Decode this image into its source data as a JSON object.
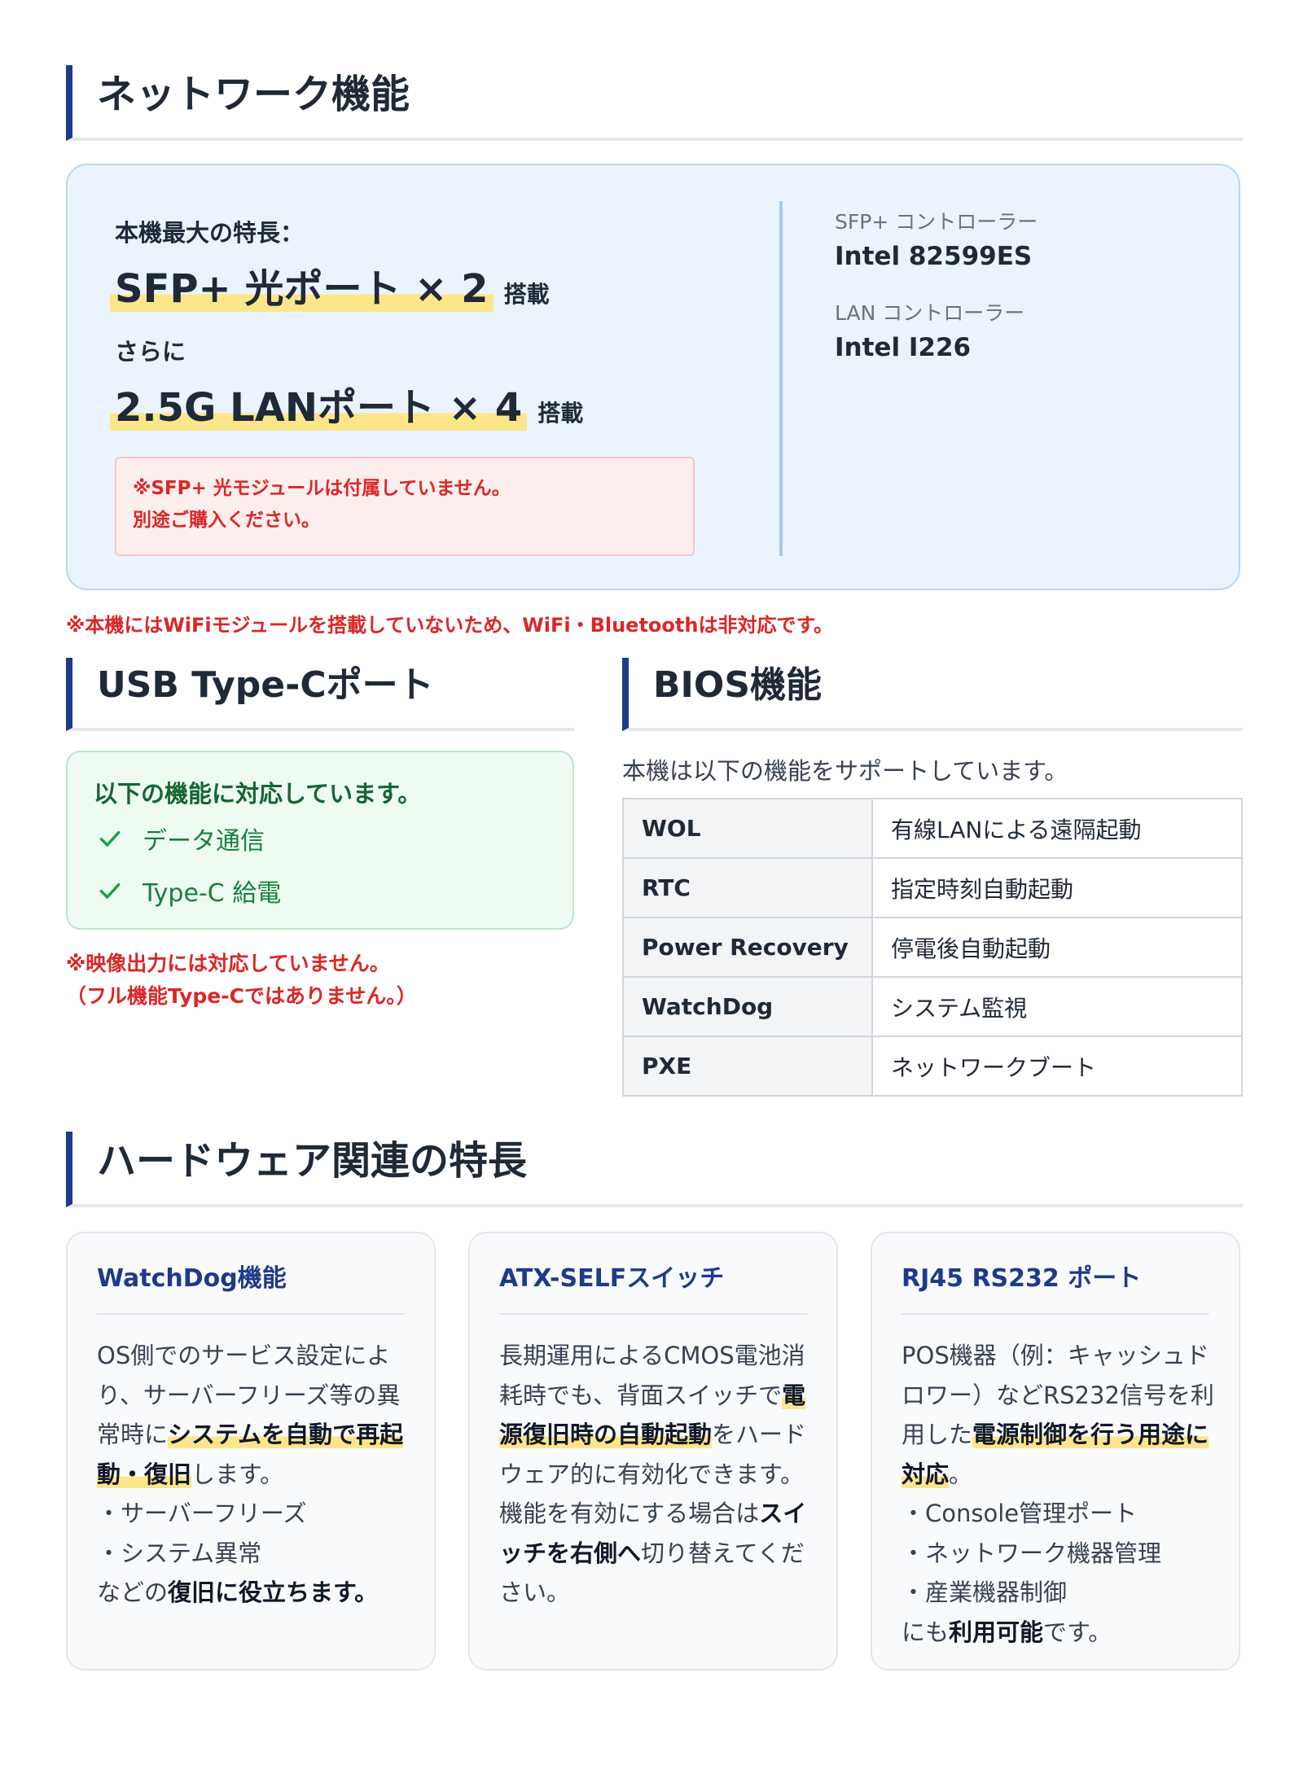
{
  "network": {
    "heading": "ネットワーク機能",
    "feature_label": "本機最大の特長：",
    "sfp_line": "SFP+ 光ポート × 2",
    "sfp_suffix": "搭載",
    "also": "さらに",
    "lan_line": "2.5G LANポート × 4",
    "lan_suffix": "搭載",
    "sfp_note_line1": "※SFP+ 光モジュールは付属していません。",
    "sfp_note_line2": "別途ご購入ください。",
    "sfp_controller_label": "SFP+ コントローラー",
    "sfp_controller_value": "Intel 82599ES",
    "lan_controller_label": "LAN コントローラー",
    "lan_controller_value": "Intel I226",
    "wifi_note": "※本機にはWiFiモジュールを搭載していないため、WiFi・Bluetoothは非対応です。"
  },
  "usb": {
    "heading": "USB Type-Cポート",
    "supported_label": "以下の機能に対応しています。",
    "features": [
      "データ通信",
      "Type-C 給電"
    ],
    "note_line1": "※映像出力には対応していません。",
    "note_line2": "（フル機能Type-Cではありません。）"
  },
  "bios": {
    "heading": "BIOS機能",
    "intro": "本機は以下の機能をサポートしています。",
    "rows": [
      {
        "key": "WOL",
        "value": "有線LANによる遠隔起動"
      },
      {
        "key": "RTC",
        "value": "指定時刻自動起動"
      },
      {
        "key": "Power Recovery",
        "value": "停電後自動起動"
      },
      {
        "key": "WatchDog",
        "value": "システム監視"
      },
      {
        "key": "PXE",
        "value": "ネットワークブート"
      }
    ]
  },
  "hardware": {
    "heading": "ハードウェア関連の特長",
    "cards": [
      {
        "title": "WatchDog機能",
        "t1": "OS側でのサービス設定により、サーバーフリーズ等の異常時に",
        "h1": "システムを自動で再起動・復旧",
        "t2": "します。",
        "b1": "・サーバーフリーズ",
        "b2": "・システム異常",
        "t3": "などの",
        "h2": "復旧に役立ちます。"
      },
      {
        "title": "ATX-SELFスイッチ",
        "t1": "長期運用によるCMOS電池消耗時でも、背面スイッチで",
        "h1": "電源復旧時の自動起動",
        "t2": "をハードウェア的に有効化できます。",
        "t3": "機能を有効にする場合は",
        "h2": "スイッチを右側へ",
        "t4": "切り替えてください。"
      },
      {
        "title": "RJ45 RS232 ポート",
        "t1": "POS機器（例：キャッシュドロワー）などRS232信号を利用した",
        "h1": "電源制御を行う用途に対応",
        "t2": "。",
        "b1": "・Console管理ポート",
        "b2": "・ネットワーク機器管理",
        "b3": "・産業機器制御",
        "t3": "にも",
        "h2": "利用可能",
        "t4": "です。"
      }
    ]
  },
  "colors": {
    "accent": "#1e3a8a",
    "note_red": "#dc2626",
    "highlight": "#fde68a",
    "usb_green": "#15803d",
    "network_bg": "#eaf3fe"
  }
}
